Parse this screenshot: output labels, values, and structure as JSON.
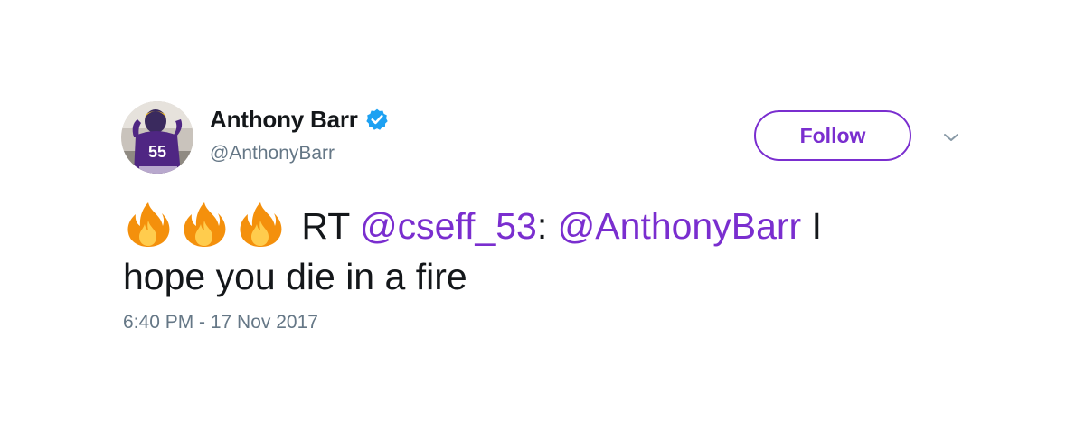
{
  "author": {
    "display_name": "Anthony Barr",
    "handle": "@AnthonyBarr",
    "verified": true,
    "avatar_jersey_number": "55"
  },
  "actions": {
    "follow_label": "Follow",
    "more_icon": "chevron-down-icon"
  },
  "tweet": {
    "emoji": [
      "fire-icon",
      "fire-icon",
      "fire-icon"
    ],
    "rt_prefix": "RT",
    "retweeted_mention": "@cseff_53",
    "separator": ":",
    "quoted_mention": "@AnthonyBarr",
    "text_line1_tail": "I",
    "text_line2": "hope you die in a fire"
  },
  "timestamp": "6:40 PM - 17 Nov 2017",
  "colors": {
    "accent": "#7a2ecf",
    "verified_badge": "#1da1f2",
    "secondary_text": "#657786",
    "primary_text": "#14171a"
  }
}
